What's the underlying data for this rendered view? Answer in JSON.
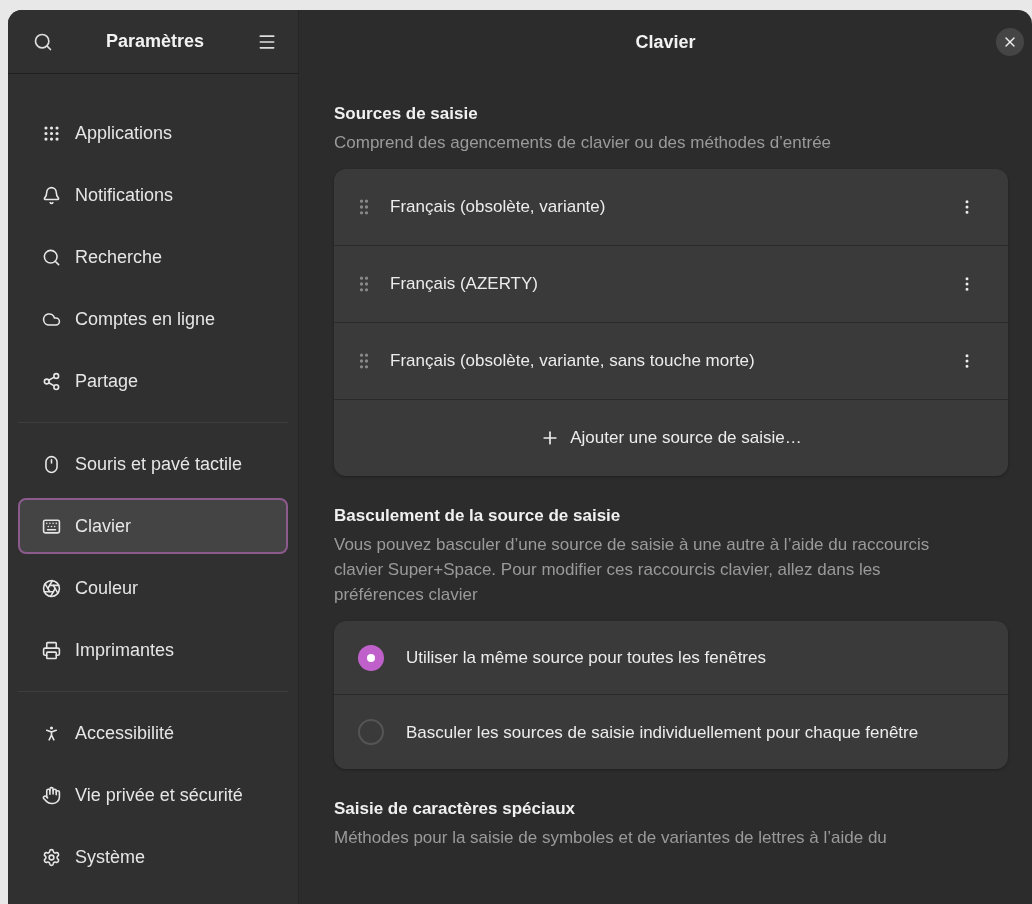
{
  "sidebar": {
    "title": "Paramètres",
    "groups": [
      [
        {
          "label": "Applications",
          "selected": false
        },
        {
          "label": "Notifications",
          "selected": false
        },
        {
          "label": "Recherche",
          "selected": false
        },
        {
          "label": "Comptes en ligne",
          "selected": false
        },
        {
          "label": "Partage",
          "selected": false
        }
      ],
      [
        {
          "label": "Souris et pavé tactile",
          "selected": false
        },
        {
          "label": "Clavier",
          "selected": true
        },
        {
          "label": "Couleur",
          "selected": false
        },
        {
          "label": "Imprimantes",
          "selected": false
        }
      ],
      [
        {
          "label": "Accessibilité",
          "selected": false
        },
        {
          "label": "Vie privée et sécurité",
          "selected": false
        },
        {
          "label": "Système",
          "selected": false
        }
      ]
    ]
  },
  "content": {
    "title": "Clavier",
    "sections": [
      {
        "kind": "list",
        "heading": "Sources de saisie",
        "description": "Comprend des agencements de clavier ou des méthodes d’entrée",
        "rows": [
          "Français (obsolète, variante)",
          "Français (AZERTY)",
          "Français (obsolète, variante, sans touche morte)"
        ],
        "add_button": "Ajouter une source de saisie…"
      },
      {
        "kind": "radios",
        "heading": "Basculement de la source de saisie",
        "description": "Vous pouvez basculer d’une source de saisie à une autre à l’aide du raccourcis clavier Super+Space. Pour modifier ces raccourcis clavier, allez dans les préférences clavier",
        "options": [
          {
            "label": "Utiliser la même source pour toutes les fenêtres",
            "selected": true
          },
          {
            "label": "Basculer les sources de saisie individuellement pour chaque fenêtre",
            "selected": false
          }
        ]
      },
      {
        "kind": "text",
        "heading": "Saisie de caractères spéciaux",
        "description": "Méthodes pour la saisie de symboles et de variantes de lettres à l’aide du"
      }
    ]
  }
}
